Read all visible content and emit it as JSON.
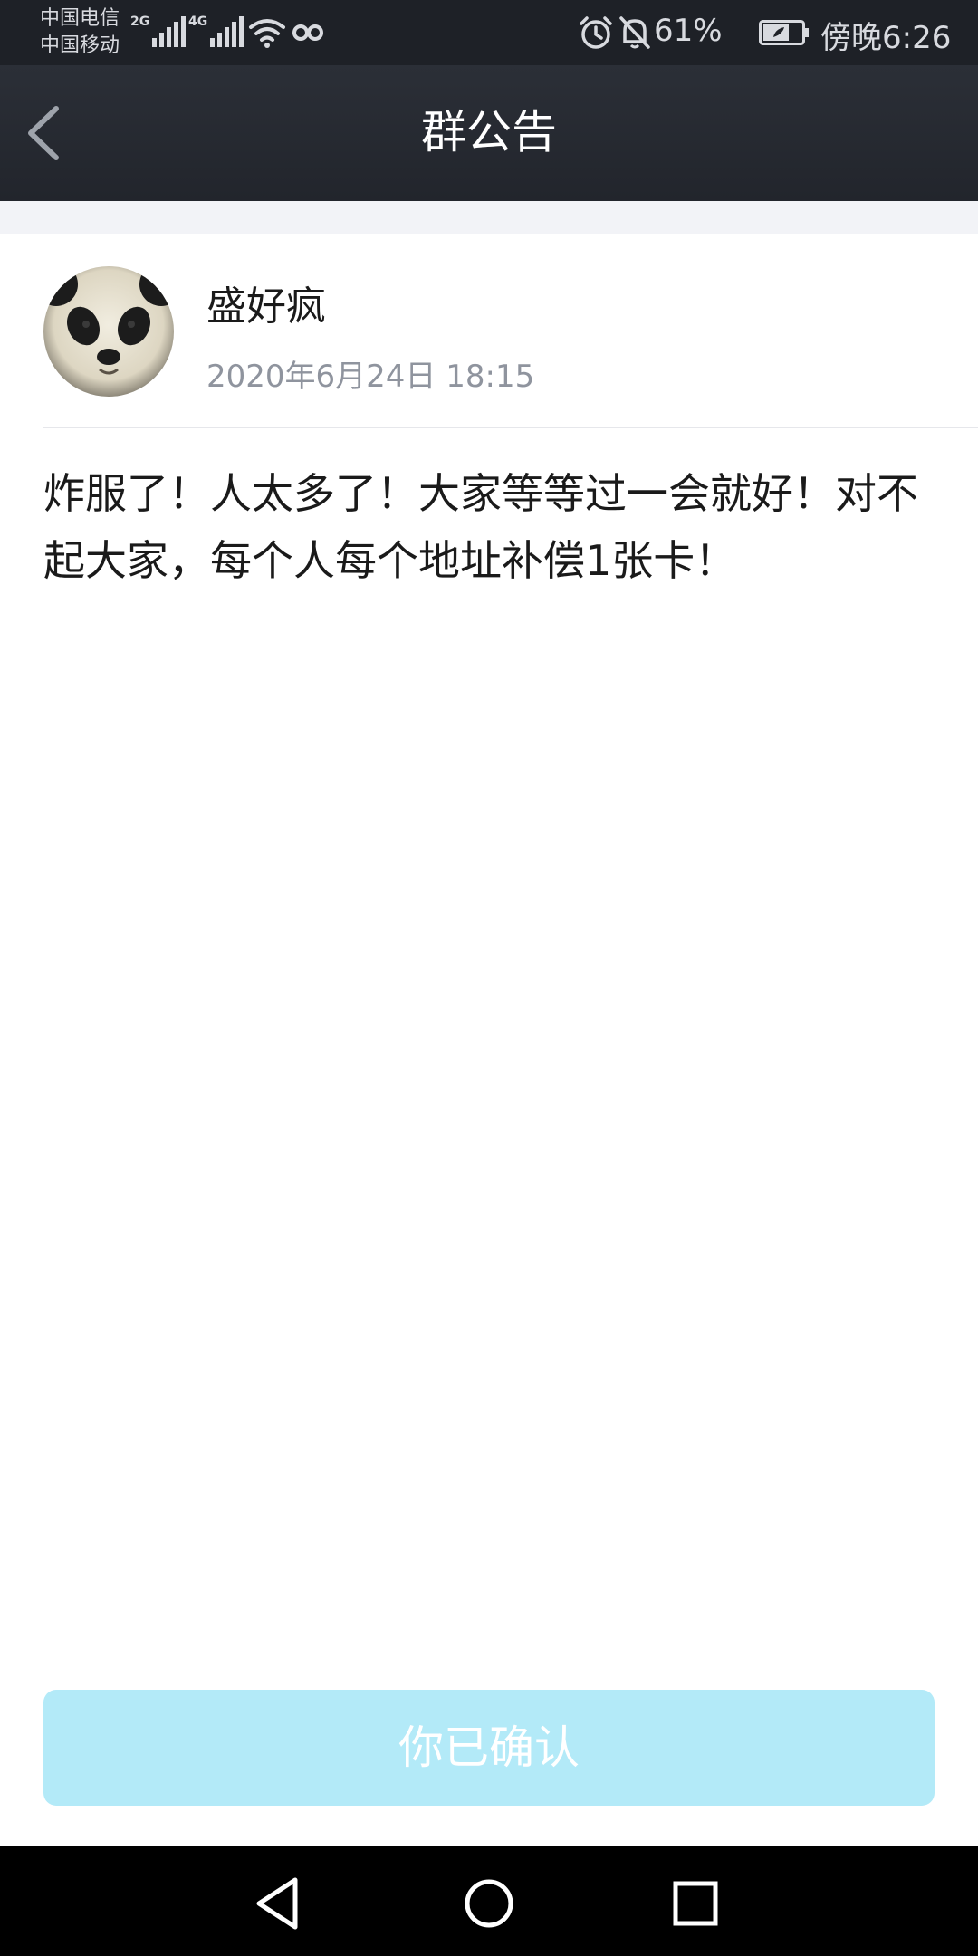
{
  "status_bar": {
    "carrier_1": "中国电信",
    "carrier_2": "中国移动",
    "signal_1_type": "2G",
    "signal_2_type": "4G",
    "battery": "61%",
    "time": "傍晚6:26",
    "icons": [
      "signal-icon",
      "wifi-icon",
      "link-icon",
      "alarm-icon",
      "bell-off-icon",
      "battery-icon"
    ]
  },
  "header": {
    "title": "群公告",
    "back_icon": "chevron-left-icon"
  },
  "post": {
    "author": "盛好疯",
    "datetime": "2020年6月24日 18:15",
    "content": "炸服了！人太多了！大家等等过一会就好！对不起大家，每个人每个地址补偿1张卡！"
  },
  "footer": {
    "confirm_label": "你已确认"
  },
  "nav": {
    "icons": [
      "back-triangle-icon",
      "home-circle-icon",
      "recents-square-icon"
    ]
  },
  "colors": {
    "header_bg": "#23262d",
    "button_bg": "#b3eaf8",
    "secondary_text": "#8f949e"
  }
}
